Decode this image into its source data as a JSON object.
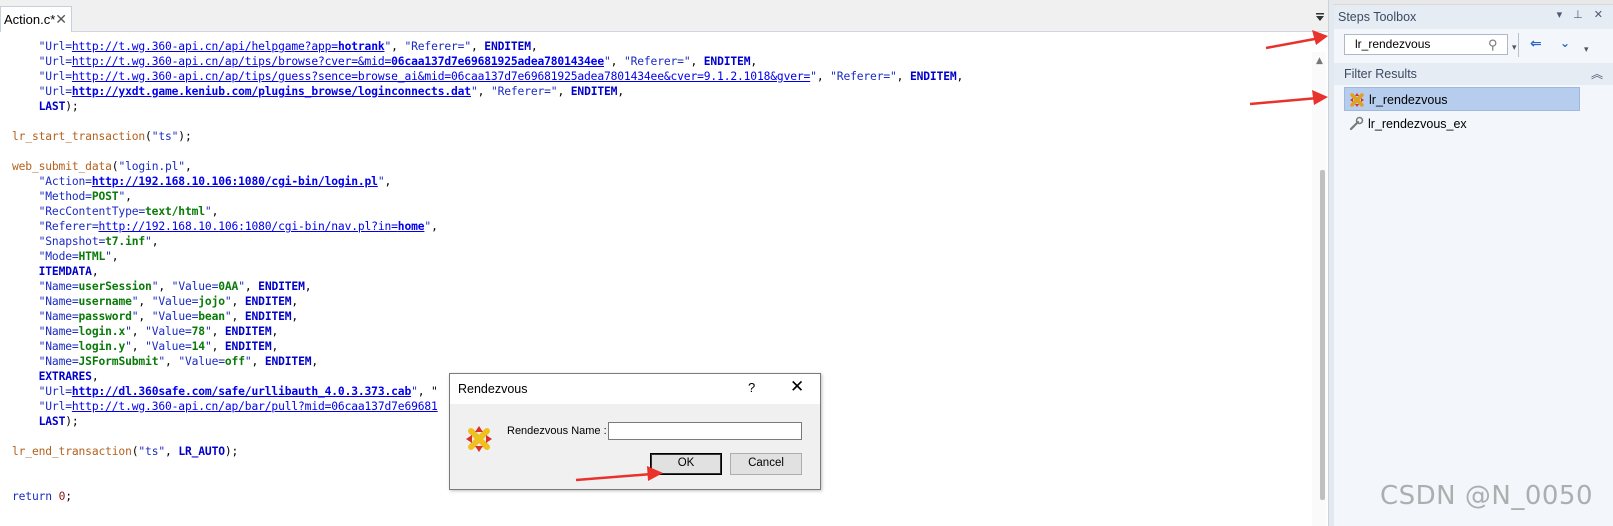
{
  "editor": {
    "tab_label": "Action.c*",
    "tab_close": "✕",
    "code_lines": [
      [
        [
          "    ",
          ""
        ],
        [
          "\"Url=",
          "str"
        ],
        [
          "http://t.wg.360-api.cn/api/helpgame?app=",
          "url"
        ],
        [
          "hotrank",
          "urlb"
        ],
        [
          "\"",
          "str"
        ],
        [
          ", ",
          ""
        ],
        [
          "\"Referer=\"",
          "str"
        ],
        [
          ", ",
          ""
        ],
        [
          "ENDITEM",
          "kw"
        ],
        [
          ",",
          ""
        ]
      ],
      [
        [
          "    ",
          ""
        ],
        [
          "\"Url=",
          "str"
        ],
        [
          "http://t.wg.360-api.cn/ap/tips/browse?cver=&mid=",
          "url"
        ],
        [
          "06caa137d7e69681925adea7801434ee",
          "urlb"
        ],
        [
          "\"",
          "str"
        ],
        [
          ", ",
          ""
        ],
        [
          "\"Referer=\"",
          "str"
        ],
        [
          ", ",
          ""
        ],
        [
          "ENDITEM",
          "kw"
        ],
        [
          ",",
          ""
        ]
      ],
      [
        [
          "    ",
          ""
        ],
        [
          "\"Url=",
          "str"
        ],
        [
          "http://t.wg.360-api.cn/ap/tips/guess?sence=browse_ai&mid=06caa137d7e69681925adea7801434ee&cver=9.1.2.1018&gver=",
          "url"
        ],
        [
          "\"",
          "str"
        ],
        [
          ", ",
          ""
        ],
        [
          "\"Referer=\"",
          "str"
        ],
        [
          ", ",
          ""
        ],
        [
          "ENDITEM",
          "kw"
        ],
        [
          ",",
          ""
        ]
      ],
      [
        [
          "    ",
          ""
        ],
        [
          "\"Url=",
          "str"
        ],
        [
          "http://yxdt.game.keniub.com/plugins_browse/loginconnects.dat",
          "urlb"
        ],
        [
          "\"",
          "str"
        ],
        [
          ", ",
          ""
        ],
        [
          "\"Referer=\"",
          "str"
        ],
        [
          ", ",
          ""
        ],
        [
          "ENDITEM",
          "kw"
        ],
        [
          ",",
          ""
        ]
      ],
      [
        [
          "    ",
          ""
        ],
        [
          "LAST",
          "kw"
        ],
        [
          ");",
          ""
        ]
      ],
      [
        [
          "",
          ""
        ]
      ],
      [
        [
          "lr_start_transaction",
          "fn"
        ],
        [
          "(",
          ""
        ],
        [
          "\"ts\"",
          "str"
        ],
        [
          ");",
          ""
        ]
      ],
      [
        [
          "",
          ""
        ]
      ],
      [
        [
          "web_submit_data",
          "fn"
        ],
        [
          "(",
          ""
        ],
        [
          "\"login.pl\"",
          "str"
        ],
        [
          ",",
          ""
        ]
      ],
      [
        [
          "    ",
          ""
        ],
        [
          "\"Action=",
          "str"
        ],
        [
          "http://192.168.10.106:1080/cgi-bin/login.pl",
          "urlb"
        ],
        [
          "\"",
          "str"
        ],
        [
          ",",
          ""
        ]
      ],
      [
        [
          "    ",
          ""
        ],
        [
          "\"Method=",
          "str"
        ],
        [
          "POST",
          "val"
        ],
        [
          "\"",
          "str"
        ],
        [
          ",",
          ""
        ]
      ],
      [
        [
          "    ",
          ""
        ],
        [
          "\"RecContentType=",
          "str"
        ],
        [
          "text/html",
          "val"
        ],
        [
          "\"",
          "str"
        ],
        [
          ",",
          ""
        ]
      ],
      [
        [
          "    ",
          ""
        ],
        [
          "\"Referer=",
          "str"
        ],
        [
          "http://192.168.10.106:1080/cgi-bin/nav.pl?in=",
          "url"
        ],
        [
          "home",
          "urlb"
        ],
        [
          "\"",
          "str"
        ],
        [
          ",",
          ""
        ]
      ],
      [
        [
          "    ",
          ""
        ],
        [
          "\"Snapshot=",
          "str"
        ],
        [
          "t7.inf",
          "val"
        ],
        [
          "\"",
          "str"
        ],
        [
          ",",
          ""
        ]
      ],
      [
        [
          "    ",
          ""
        ],
        [
          "\"Mode=",
          "str"
        ],
        [
          "HTML",
          "val"
        ],
        [
          "\"",
          "str"
        ],
        [
          ",",
          ""
        ]
      ],
      [
        [
          "    ",
          ""
        ],
        [
          "ITEMDATA",
          "kw"
        ],
        [
          ",",
          ""
        ]
      ],
      [
        [
          "    ",
          ""
        ],
        [
          "\"Name=",
          "str"
        ],
        [
          "userSession",
          "val"
        ],
        [
          "\"",
          "str"
        ],
        [
          ", ",
          ""
        ],
        [
          "\"Value=",
          "str"
        ],
        [
          "0AA",
          "val"
        ],
        [
          "\"",
          "str"
        ],
        [
          ", ",
          ""
        ],
        [
          "ENDITEM",
          "kw"
        ],
        [
          ",",
          ""
        ]
      ],
      [
        [
          "    ",
          ""
        ],
        [
          "\"Name=",
          "str"
        ],
        [
          "username",
          "val"
        ],
        [
          "\"",
          "str"
        ],
        [
          ", ",
          ""
        ],
        [
          "\"Value=",
          "str"
        ],
        [
          "jojo",
          "val"
        ],
        [
          "\"",
          "str"
        ],
        [
          ", ",
          ""
        ],
        [
          "ENDITEM",
          "kw"
        ],
        [
          ",",
          ""
        ]
      ],
      [
        [
          "    ",
          ""
        ],
        [
          "\"Name=",
          "str"
        ],
        [
          "password",
          "val"
        ],
        [
          "\"",
          "str"
        ],
        [
          ", ",
          ""
        ],
        [
          "\"Value=",
          "str"
        ],
        [
          "bean",
          "val"
        ],
        [
          "\"",
          "str"
        ],
        [
          ", ",
          ""
        ],
        [
          "ENDITEM",
          "kw"
        ],
        [
          ",",
          ""
        ]
      ],
      [
        [
          "    ",
          ""
        ],
        [
          "\"Name=",
          "str"
        ],
        [
          "login.x",
          "val"
        ],
        [
          "\"",
          "str"
        ],
        [
          ", ",
          ""
        ],
        [
          "\"Value=",
          "str"
        ],
        [
          "78",
          "val"
        ],
        [
          "\"",
          "str"
        ],
        [
          ", ",
          ""
        ],
        [
          "ENDITEM",
          "kw"
        ],
        [
          ",",
          ""
        ]
      ],
      [
        [
          "    ",
          ""
        ],
        [
          "\"Name=",
          "str"
        ],
        [
          "login.y",
          "val"
        ],
        [
          "\"",
          "str"
        ],
        [
          ", ",
          ""
        ],
        [
          "\"Value=",
          "str"
        ],
        [
          "14",
          "val"
        ],
        [
          "\"",
          "str"
        ],
        [
          ", ",
          ""
        ],
        [
          "ENDITEM",
          "kw"
        ],
        [
          ",",
          ""
        ]
      ],
      [
        [
          "    ",
          ""
        ],
        [
          "\"Name=",
          "str"
        ],
        [
          "JSFormSubmit",
          "val"
        ],
        [
          "\"",
          "str"
        ],
        [
          ", ",
          ""
        ],
        [
          "\"Value=",
          "str"
        ],
        [
          "off",
          "val"
        ],
        [
          "\"",
          "str"
        ],
        [
          ", ",
          ""
        ],
        [
          "ENDITEM",
          "kw"
        ],
        [
          ",",
          ""
        ]
      ],
      [
        [
          "    ",
          ""
        ],
        [
          "EXTRARES",
          "kw"
        ],
        [
          ",",
          ""
        ]
      ],
      [
        [
          "    ",
          ""
        ],
        [
          "\"Url=",
          "str"
        ],
        [
          "http://dl.360safe.com/safe/urllibauth_4.0.3.373.cab",
          "urlb"
        ],
        [
          "\"",
          "str"
        ],
        [
          ", \"",
          ""
        ]
      ],
      [
        [
          "    ",
          ""
        ],
        [
          "\"Url=",
          "str"
        ],
        [
          "http://t.wg.360-api.cn/ap/bar/pull?mid=06caa137d7e69681",
          "url"
        ]
      ],
      [
        [
          "    ",
          ""
        ],
        [
          "LAST",
          "kw"
        ],
        [
          ");",
          ""
        ]
      ],
      [
        [
          "",
          ""
        ]
      ],
      [
        [
          "lr_end_transaction",
          "fn"
        ],
        [
          "(",
          ""
        ],
        [
          "\"ts\"",
          "str"
        ],
        [
          ", ",
          ""
        ],
        [
          "LR_AUTO",
          "kw"
        ],
        [
          ");",
          ""
        ]
      ],
      [
        [
          "",
          ""
        ]
      ],
      [
        [
          "",
          ""
        ]
      ],
      [
        [
          "return ",
          "str"
        ],
        [
          "0",
          "num"
        ],
        [
          ";",
          ""
        ]
      ]
    ]
  },
  "toolbox": {
    "title": "Steps Toolbox",
    "header_icons": "▾ ⊥ ✕",
    "search_value": "lr_rendezvous",
    "filter_results_label": "Filter Results",
    "results": [
      {
        "label": "lr_rendezvous",
        "selected": true,
        "icon": "rendezvous-icon"
      },
      {
        "label": "lr_rendezvous_ex",
        "selected": false,
        "icon": "wrench-icon"
      }
    ]
  },
  "dialog": {
    "title": "Rendezvous",
    "help": "?",
    "close": "✕",
    "name_label": "Rendezvous Name :",
    "name_value": "",
    "ok_label": "OK",
    "cancel_label": "Cancel"
  },
  "watermark": "CSDN @N_0050",
  "colors": {
    "accent": "#b7cdee",
    "annotation_arrow": "#e8322b",
    "code_string": "#1b2bc4",
    "code_keyword": "#0000cc",
    "code_value": "#0a7a0a",
    "code_function": "#b4611d"
  }
}
